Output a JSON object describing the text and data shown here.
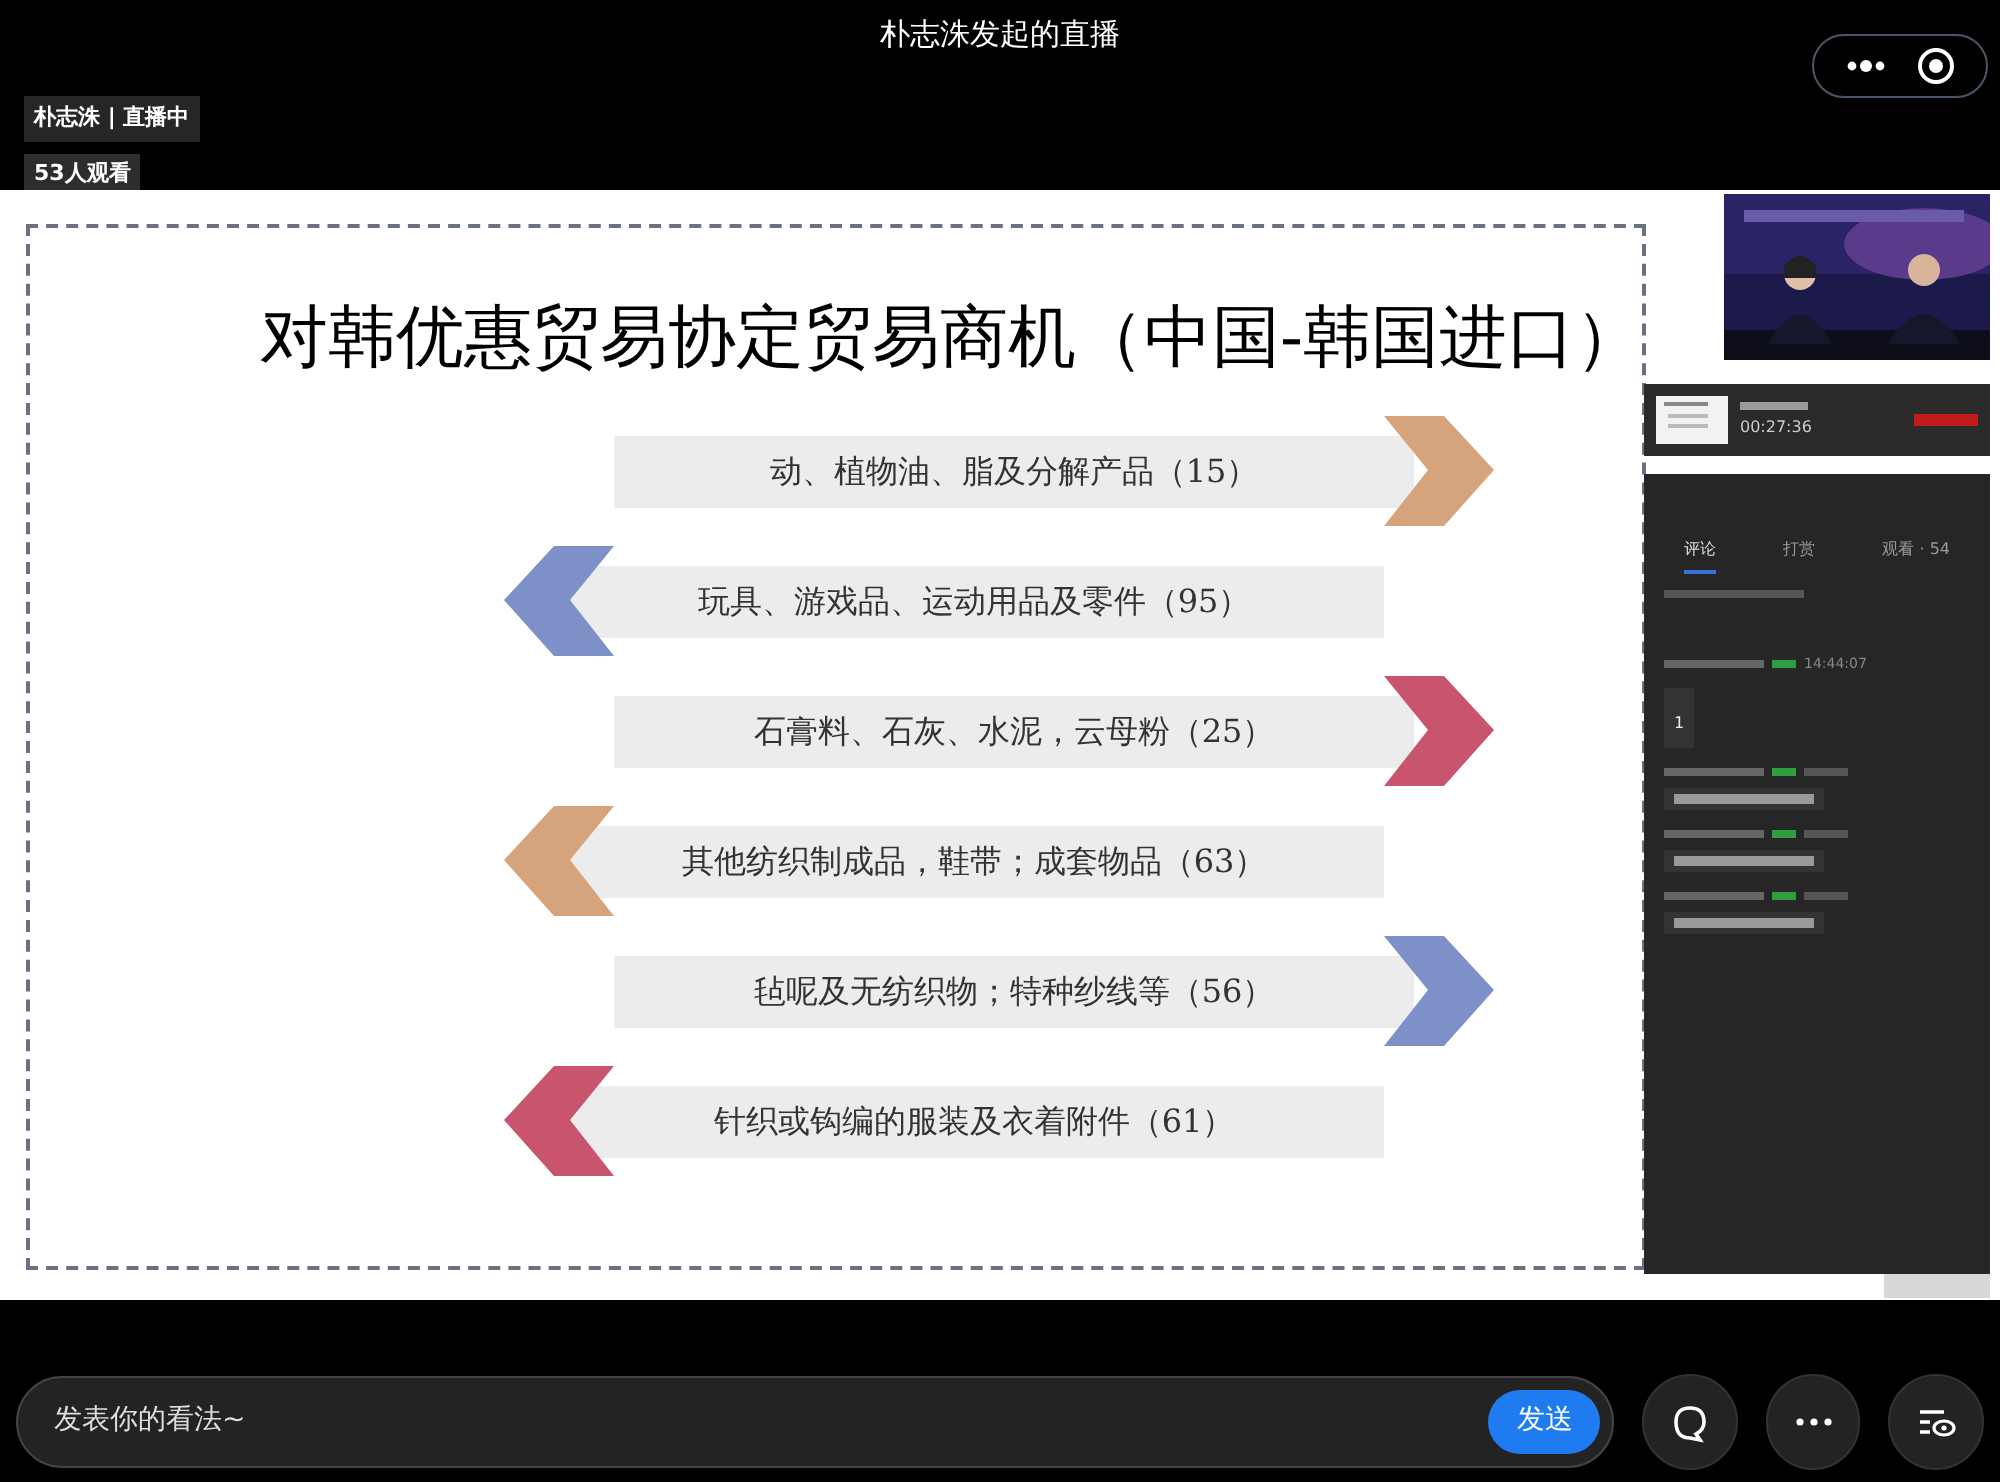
{
  "window": {
    "title": "朴志洙发起的直播"
  },
  "host_badge": "朴志洙 | 直播中",
  "viewer_badge": "53人观看",
  "slide": {
    "title": "对韩优惠贸易协定贸易商机（中国-韩国进口）",
    "rows": [
      {
        "label": "动、植物油、脂及分解产品（15）",
        "kind": "right",
        "color": "#d6a47c"
      },
      {
        "label": "玩具、游戏品、运动用品及零件（95）",
        "kind": "left",
        "color": "#7d90c8"
      },
      {
        "label": "石膏料、石灰、水泥，云母粉（25）",
        "kind": "right",
        "color": "#c8546e"
      },
      {
        "label": "其他纺织制成品，鞋带；成套物品（63）",
        "kind": "left",
        "color": "#d6a47c"
      },
      {
        "label": "毡呢及无纺织物；特种纱线等（56）",
        "kind": "right",
        "color": "#7d90c8"
      },
      {
        "label": "针织或钩编的服装及衣着附件（61）",
        "kind": "left",
        "color": "#c8546e"
      }
    ]
  },
  "side_panel": {
    "mini_player": {
      "time": "00:27:36"
    },
    "tabs": [
      {
        "label": "评论",
        "selected": true
      },
      {
        "label": "打赏",
        "selected": false
      },
      {
        "label": "观看 · 54",
        "selected": false
      }
    ],
    "comments": [
      {
        "kind": "readable",
        "time": "14:44:07",
        "text": "1"
      },
      {
        "kind": "blurred"
      },
      {
        "kind": "blurred"
      },
      {
        "kind": "blurred"
      }
    ]
  },
  "composer": {
    "placeholder": "发表你的看法~",
    "send": "发送"
  }
}
